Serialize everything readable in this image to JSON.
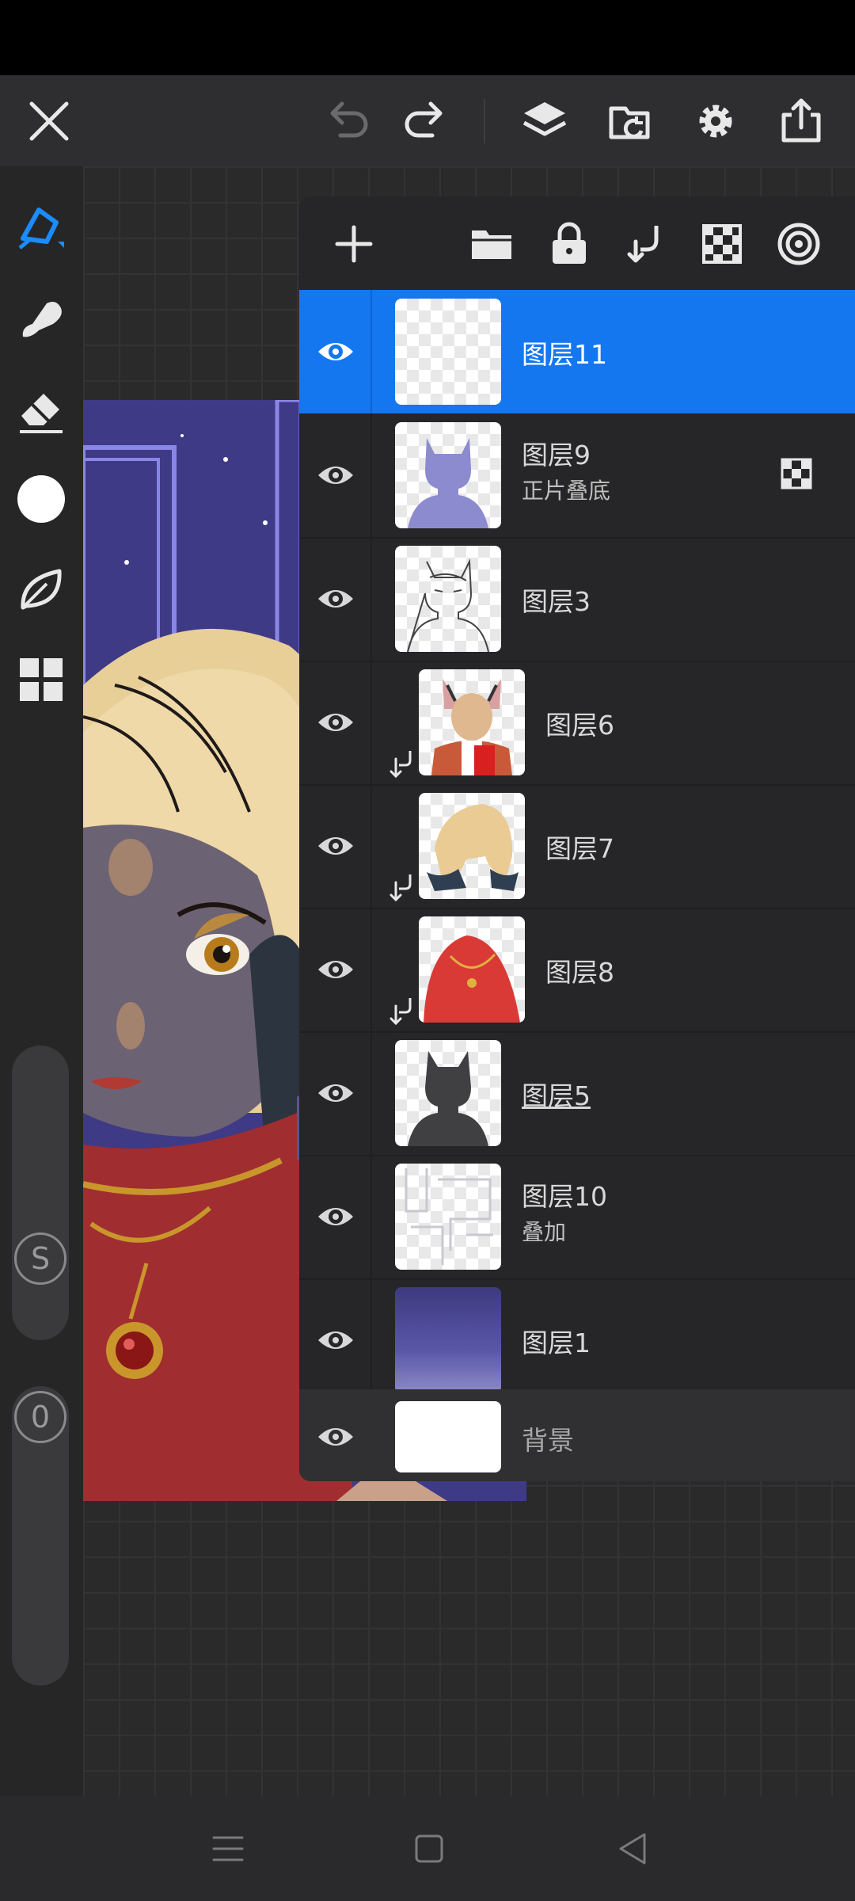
{
  "app": {
    "accent": "#1477f0",
    "toolbar": {
      "buttons": [
        "close-icon",
        "undo-icon",
        "redo-icon",
        "layers-icon",
        "import-icon",
        "settings-icon",
        "export-icon"
      ]
    },
    "left_tools": [
      "pen-icon",
      "smudge-icon",
      "eraser-icon",
      "color-icon",
      "leaf-brush-icon",
      "gallery-icon"
    ],
    "slider_size": {
      "label": "S"
    },
    "slider_opacity": {
      "label": "0"
    }
  },
  "layers_panel": {
    "actions": [
      "add-layer-icon",
      "folder-icon",
      "lock-icon",
      "clip-icon",
      "transparency-icon",
      "reference-icon"
    ],
    "layers": [
      {
        "name": "图层11",
        "mode": "",
        "selected": true
      },
      {
        "name": "图层9",
        "mode": "正片叠底"
      },
      {
        "name": "图层3",
        "mode": ""
      },
      {
        "name": "图层6",
        "mode": "",
        "clipped": true
      },
      {
        "name": "图层7",
        "mode": "",
        "clipped": true
      },
      {
        "name": "图层8",
        "mode": "",
        "clipped": true
      },
      {
        "name": "图层5",
        "mode": ""
      },
      {
        "name": "图层10",
        "mode": "叠加"
      },
      {
        "name": "图层1",
        "mode": ""
      }
    ],
    "background": {
      "name": "背景"
    }
  },
  "navbar": [
    "menu-icon",
    "home-icon",
    "back-icon"
  ]
}
